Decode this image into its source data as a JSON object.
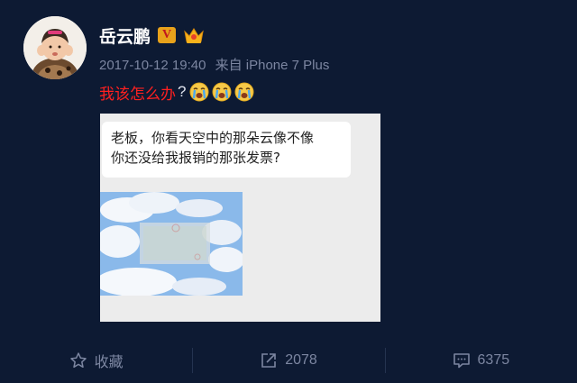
{
  "user": {
    "name": "岳云鹏"
  },
  "meta": {
    "timestamp": "2017-10-12 19:40",
    "source": "来自 iPhone 7 Plus"
  },
  "post": {
    "text_red": "我该怎么办",
    "text_q": "?"
  },
  "chat_bubble": {
    "line1": "老板，你看天空中的那朵云像不像",
    "line2": "你还没给我报销的那张发票?"
  },
  "toolbar": {
    "favorite_label": "收藏",
    "repost_count": "2078",
    "comment_count": "6375"
  },
  "icons": {
    "verified": "verified-v-icon",
    "crown": "crown-icon",
    "emoji": "crying-emoji-icon",
    "favorite": "star-icon",
    "repost": "share-icon",
    "comment": "comment-icon"
  },
  "colors": {
    "background": "#0d1a33",
    "accent_red": "#ff2020",
    "muted": "#7c86a1"
  }
}
